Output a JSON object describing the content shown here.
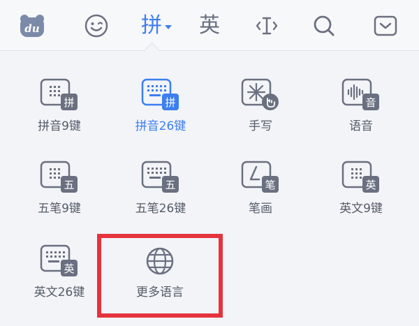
{
  "toolbar": {
    "pinyin_label": "拼",
    "english_label": "英"
  },
  "layouts": [
    {
      "label": "拼音9键",
      "badge": "拼"
    },
    {
      "label": "拼音26键",
      "badge": "拼"
    },
    {
      "label": "手写"
    },
    {
      "label": "语音",
      "badge": "音"
    },
    {
      "label": "五笔9键",
      "badge": "五"
    },
    {
      "label": "五笔26键",
      "badge": "五"
    },
    {
      "label": "笔画",
      "badge": "笔"
    },
    {
      "label": "英文9键",
      "badge": "英"
    },
    {
      "label": "英文26键",
      "badge": "英"
    },
    {
      "label": "更多语言"
    }
  ],
  "colors": {
    "accent": "#3d7ef0",
    "icon": "#6a7080",
    "highlight_border": "#e5333d"
  }
}
